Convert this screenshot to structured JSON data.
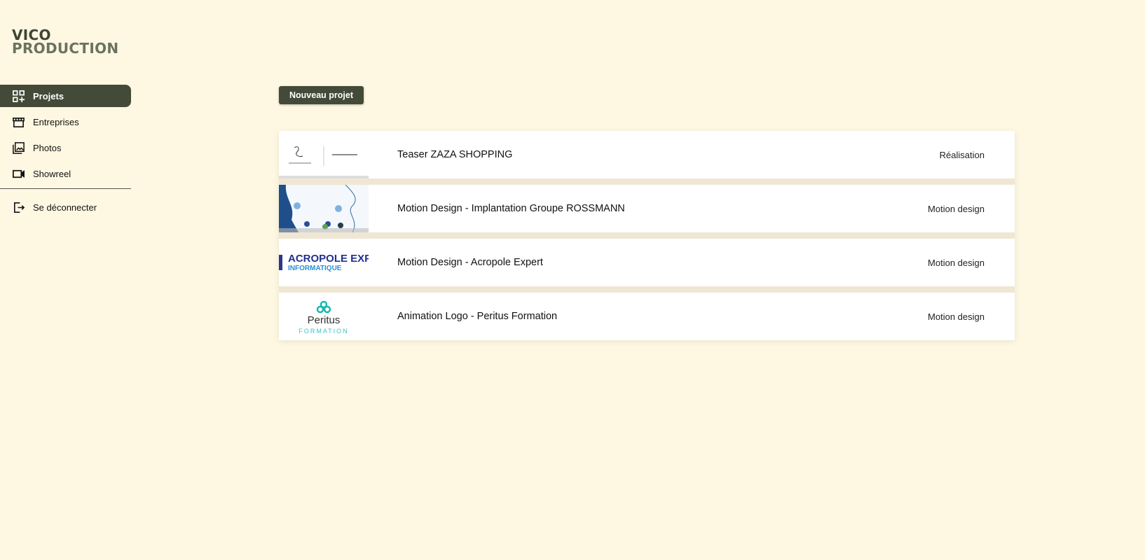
{
  "logo": {
    "line1": "VICO",
    "line2": "PRODUCTION"
  },
  "sidebar": {
    "items": [
      {
        "label": "Projets",
        "icon": "grid-plus-icon",
        "active": true
      },
      {
        "label": "Entreprises",
        "icon": "store-icon"
      },
      {
        "label": "Photos",
        "icon": "photos-icon"
      },
      {
        "label": "Showreel",
        "icon": "video-camera-icon"
      }
    ],
    "logout": {
      "label": "Se déconnecter",
      "icon": "logout-icon"
    }
  },
  "toolbar": {
    "new_project": "Nouveau projet"
  },
  "projects": [
    {
      "title": "Teaser ZAZA SHOPPING",
      "category": "Réalisation"
    },
    {
      "title": "Motion Design - Implantation Groupe ROSSMANN",
      "category": "Motion design"
    },
    {
      "title": "Motion Design - Acropole Expert",
      "category": "Motion design",
      "thumb_text": [
        "ACROPOLE EXPE",
        "INFORMATIQUE"
      ]
    },
    {
      "title": "Animation Logo - Peritus Formation",
      "category": "Motion design",
      "thumb_text": [
        "Peritus",
        "FORMATION"
      ]
    }
  ],
  "colors": {
    "background": "#fef7e2",
    "accent": "#434a38"
  }
}
